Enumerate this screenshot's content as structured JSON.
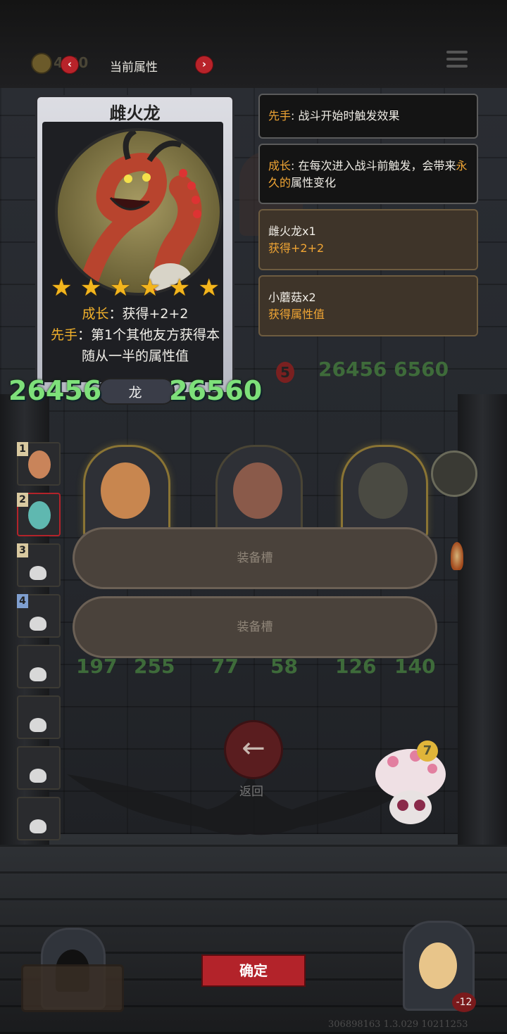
{
  "header": {
    "gold": "4·20",
    "title": "当前属性",
    "prev": "‹",
    "next": "›"
  },
  "card": {
    "name": "雌火龙",
    "stars": 6,
    "desc_growth_label": "成长",
    "desc_growth_text": "：获得+2+2",
    "desc_first_label": "先手",
    "desc_first_text": "：第1个其他友方获得本随从一半的属性值",
    "attack": "26456",
    "health": "26560",
    "tribe": "龙"
  },
  "tips": [
    {
      "key": "先手",
      "text": ": 战斗开始时触发效果"
    },
    {
      "key": "成长",
      "text_a": ": 在每次进入战斗前触发，会带来",
      "highlight": "永久的",
      "text_b": "属性变化"
    },
    {
      "line1": "雌火龙x1",
      "line2": "获得+2+2"
    },
    {
      "line1": "小蘑菇x2",
      "line2": "获得属性值"
    }
  ],
  "board": {
    "ghost_top_level": "5",
    "ghost_top_stats": "26456 6560",
    "row_stats": [
      [
        "197",
        "255"
      ],
      [
        "77",
        "58"
      ],
      [
        "126",
        "140"
      ]
    ]
  },
  "side_slots": [
    "1",
    "2",
    "3",
    "4"
  ],
  "equip_slots": [
    "装备槽",
    "装备槽"
  ],
  "back_label": "返回",
  "confirm_label": "确定",
  "mush_level": "7",
  "hero_hp": "-12",
  "version": "306898163 1.3.029 10211253",
  "colors": {
    "accent_red": "#b3232a",
    "stat_green": "#7ee07a",
    "gold_orange": "#f0a534"
  }
}
